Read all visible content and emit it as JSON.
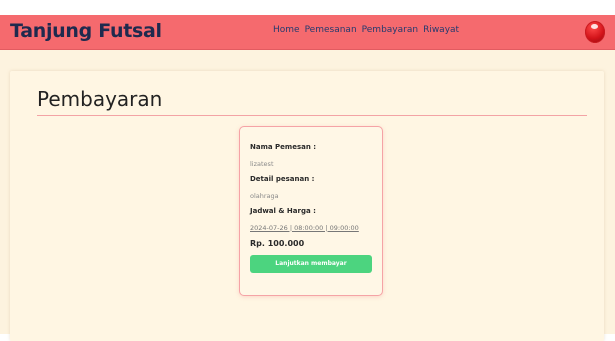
{
  "header": {
    "brand": "Tanjung Futsal",
    "nav": [
      "Home",
      "Pemesanan",
      "Pembayaran",
      "Riwayat"
    ],
    "avatar_icon": "user-avatar-icon",
    "bar_color": "#f56a6e"
  },
  "page": {
    "title": "Pembayaran"
  },
  "order": {
    "name_label": "Nama Pemesan :",
    "name_value": "lizatest",
    "detail_label": "Detail pesanan :",
    "detail_value": "olahraga",
    "schedule_label": "Jadwal & Harga :",
    "schedule_value": "2024-07-26 | 08:00:00 | 09:00:00",
    "price": "Rp. 100.000",
    "pay_button": "Lanjutkan membayar",
    "pay_button_color": "#4cd47f"
  }
}
